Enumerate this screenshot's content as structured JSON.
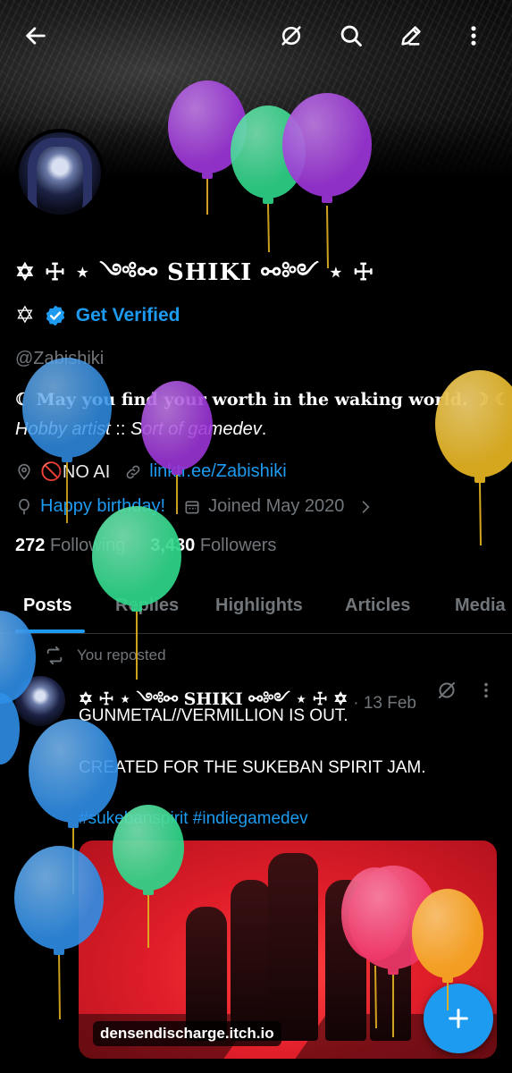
{
  "header": {
    "back_icon": "arrow-left-icon",
    "grok_icon": "grok-icon",
    "search_icon": "search-icon",
    "edit_icon": "edit-icon",
    "more_icon": "more-vertical-icon"
  },
  "profile": {
    "display_name": "✡ ☩ ⋆ ༺⚯ SHIKI ⚯༻ ⋆ ☩",
    "prefix_glyph": "✡",
    "get_verified": "Get Verified",
    "handle": "@Zabishiki",
    "bio_line1": "☾ May you find your worth in the waking world. ☽ ☾",
    "bio_line2_a": "Hobby artist",
    "bio_line2_b": " :: ",
    "bio_line2_c": "Sort of gamedev",
    "bio_line2_d": ".",
    "location": "🚫NO AI",
    "link": "linktr.ee/Zabishiki",
    "birthday": "Happy birthday!",
    "joined": "Joined May 2020",
    "following_count": "272",
    "following_label": "Following",
    "followers_count": "3,430",
    "followers_label": "Followers"
  },
  "tabs": [
    "Posts",
    "Replies",
    "Highlights",
    "Articles",
    "Media"
  ],
  "feed": {
    "repost_label": "You reposted",
    "post": {
      "author": "✡ ☩ ⋆ ༺⚯ SHIKI ⚯༻ ⋆ ☩ ✡",
      "date": "· 13 Feb",
      "line1": "GUNMETAL//VERMILLION IS OUT.",
      "line2": "CREATED FOR THE SUKEBAN SPIRIT JAM.",
      "hashtags": "#sukebanspirit #indiegamedev",
      "media_label": "densendischarge.itch.io"
    }
  },
  "colors": {
    "accent": "#1d9bf0",
    "muted": "#71767b",
    "background": "#000000",
    "balloon_purple": "#9b35d6",
    "balloon_green": "#2fd68a",
    "balloon_blue": "#2f8ee6",
    "balloon_yellow": "#e0b021",
    "balloon_pink": "#f0386a",
    "balloon_orange": "#f5a623"
  }
}
